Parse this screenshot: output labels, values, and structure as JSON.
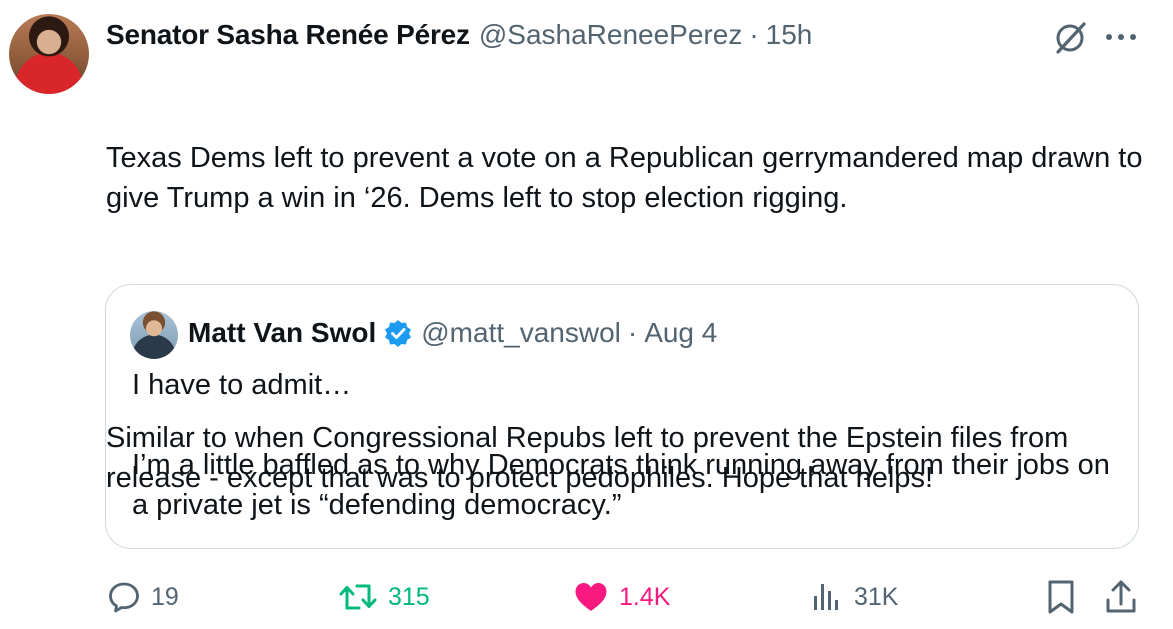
{
  "tweet": {
    "author": {
      "display_name": "Senator Sasha Renée Pérez",
      "handle": "@SashaReneePerez",
      "time": "15h"
    },
    "text_paragraphs": [
      "Texas Dems left to prevent a vote on a Republican gerrymandered map drawn to give Trump a win in ‘26. Dems left to stop election rigging.",
      "Similar to when Congressional Repubs left to prevent the Epstein files from release - except that was to protect pedophiles. Hope that helps!"
    ],
    "separator": "·"
  },
  "quote": {
    "author": {
      "display_name": "Matt Van Swol",
      "handle": "@matt_vanswol",
      "time": "Aug 4",
      "verified": true
    },
    "text_paragraphs": [
      "I have to admit…",
      "I’m a little baffled as to why Democrats think running away from their jobs on a private jet is “defending democracy.”"
    ],
    "separator": "·"
  },
  "actions": {
    "replies": "19",
    "retweets": "315",
    "likes": "1.4K",
    "views": "31K"
  },
  "colors": {
    "text": "#0f1419",
    "secondary": "#536471",
    "retweet_green": "#00ba7c",
    "like_pink": "#f91880",
    "verified_blue": "#1d9bf0",
    "border": "#cfd9de"
  },
  "icons": [
    "grok-icon",
    "more-icon",
    "verified-icon",
    "reply-icon",
    "retweet-icon",
    "heart-icon",
    "views-icon",
    "bookmark-icon",
    "share-icon"
  ]
}
